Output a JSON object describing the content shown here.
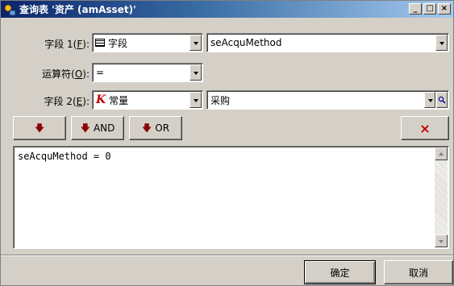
{
  "window": {
    "title": "查询表 '资产 (amAsset)'",
    "controls": [
      "_",
      "□",
      "×"
    ]
  },
  "field1": {
    "label_prefix": "字段 1(",
    "hotkey": "F",
    "label_suffix": "):",
    "type": "字段",
    "value": "seAcquMethod"
  },
  "operator": {
    "label_prefix": "运算符(",
    "hotkey": "O",
    "label_suffix": "):",
    "value": "="
  },
  "field2": {
    "label_prefix": "字段 2(",
    "hotkey": "E",
    "label_suffix": "):",
    "type": "常量",
    "value": "采购"
  },
  "buttons": {
    "insert_arrow": "🡇",
    "and_label": "AND",
    "or_label": "OR",
    "clear_symbol": "×"
  },
  "query": {
    "text": "seAcquMethod = 0"
  },
  "footer": {
    "ok_label": "确定",
    "cancel_label": "取消"
  },
  "colors": {
    "title_bar": "#0a246a",
    "arrow": "#8b0000",
    "face": "#d4d0c8"
  }
}
